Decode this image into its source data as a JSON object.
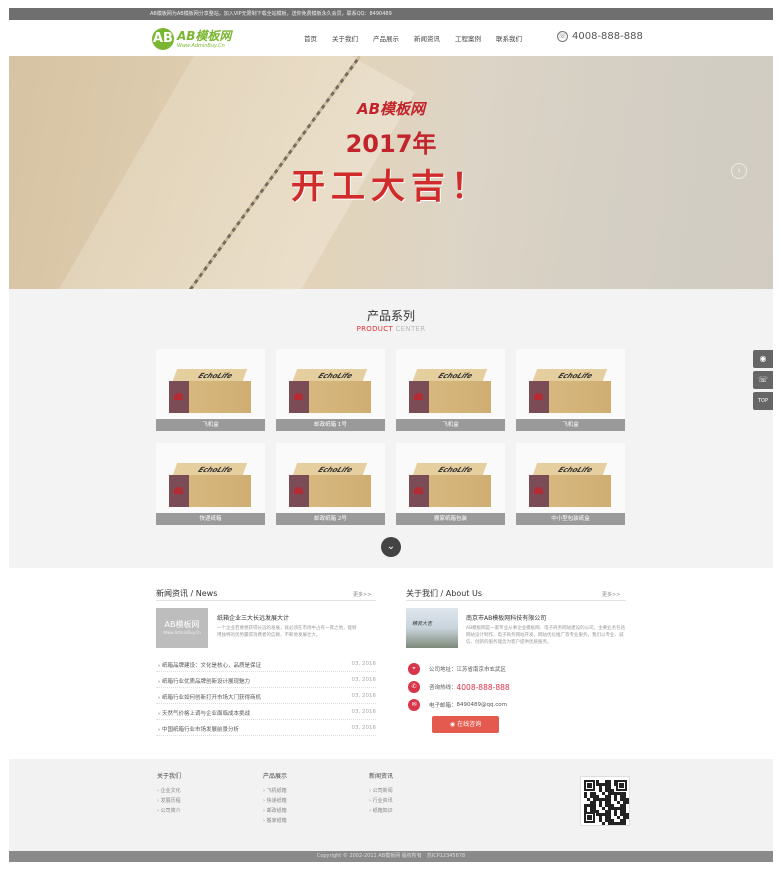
{
  "topbar": {
    "text": "AB模板网为AB模板网分享整站，加入VIP无限制下载全站模板，送你免费模板永久会员，联系QQ：8490489"
  },
  "header": {
    "logo_badge": "AB",
    "logo_main": "AB模板网",
    "logo_sub": "Www.AdminBuy.Cn",
    "nav": [
      "首页",
      "关于我们",
      "产品展示",
      "新闻资讯",
      "工程案例",
      "联系我们"
    ],
    "phone_icon": "phone-icon",
    "phone": "4008-888-888"
  },
  "banner": {
    "line1": "AB模板网",
    "line2": "2017年",
    "line3": "开工大吉！",
    "next_icon": "chevron-right-icon"
  },
  "products": {
    "title": "产品系列",
    "sub_red": "PRODUCT",
    "sub_gray": " CENTER",
    "box_label": "EchoLife",
    "items": [
      {
        "caption": "飞机盒"
      },
      {
        "caption": "邮政纸箱 1号"
      },
      {
        "caption": "飞机盒"
      },
      {
        "caption": "飞机盒"
      },
      {
        "caption": "快递纸箱"
      },
      {
        "caption": "邮政纸箱 2号"
      },
      {
        "caption": "搬家纸箱包装"
      },
      {
        "caption": "中小型包装纸盒"
      }
    ],
    "more_icon": "chevron-down-icon"
  },
  "side_tools": [
    {
      "icon": "qq-icon",
      "glyph": "◉"
    },
    {
      "icon": "phone-icon",
      "glyph": "☏"
    },
    {
      "icon": "top-icon",
      "glyph": "TOP"
    }
  ],
  "news": {
    "heading": "新闻资讯 / News",
    "more": "更多>>",
    "thumb_title": "AB模板网",
    "thumb_sub": "Www.AdminBuy.Cn",
    "featured_title": "纸箱企业三大长远发展大计",
    "featured_desc": "一个企业若要想获得长远的发展，就必须在市场中占有一席之地，能够用独特的优势赢得消费者的信赖，不断地发展壮大。",
    "items": [
      {
        "title": "纸箱品牌建设：文化是核心，品质是保证",
        "date": "03, 2016"
      },
      {
        "title": "纸箱行业优质品牌创新设计展现魅力",
        "date": "03, 2016"
      },
      {
        "title": "纸箱行业如何创新打开市场大门获得商机",
        "date": "03, 2016"
      },
      {
        "title": "天然气价格上调与企业面临成本挑战",
        "date": "03, 2016"
      },
      {
        "title": "中国纸箱行业市场发展前景分析",
        "date": "03, 2016"
      }
    ]
  },
  "about": {
    "heading": "关于我们 / About Us",
    "more": "更多>>",
    "img_text": "精装大吉",
    "title": "南京市AB模板网科技有限公司",
    "desc": "AB模板网是一家专业从事企业模板网、电子商务网站建设的公司，主要业务包括网站设计制作，电子商务网站开发，网站优化推广等专业服务。我们以专业、诚信、创新的服务理念为客户提供优质服务。",
    "contacts": [
      {
        "icon": "location-icon",
        "glyph": "⌖",
        "label": "公司地址：",
        "value": "江苏省南京市玄武区",
        "red": false
      },
      {
        "icon": "phone-circle-icon",
        "glyph": "✆",
        "label": "咨询热线：",
        "value": "4008-888-888",
        "red": true
      },
      {
        "icon": "mail-icon",
        "glyph": "✉",
        "label": "电子邮箱：",
        "value": "8490489@qq.com",
        "red": false
      }
    ],
    "consult": "在线咨询"
  },
  "footer": {
    "cols": [
      {
        "head": "关于我们",
        "items": [
          "企业文化",
          "发展历程",
          "公司简介"
        ]
      },
      {
        "head": "产品展示",
        "items": [
          "飞机纸箱",
          "快递纸箱",
          "邮政纸箱",
          "搬家纸箱"
        ]
      },
      {
        "head": "新闻资讯",
        "items": [
          "公司新闻",
          "行业资讯",
          "纸箱知识"
        ]
      }
    ],
    "copyright": "Copyright © 2002-2011 AB模板网 版权所有　苏ICP12345678"
  }
}
